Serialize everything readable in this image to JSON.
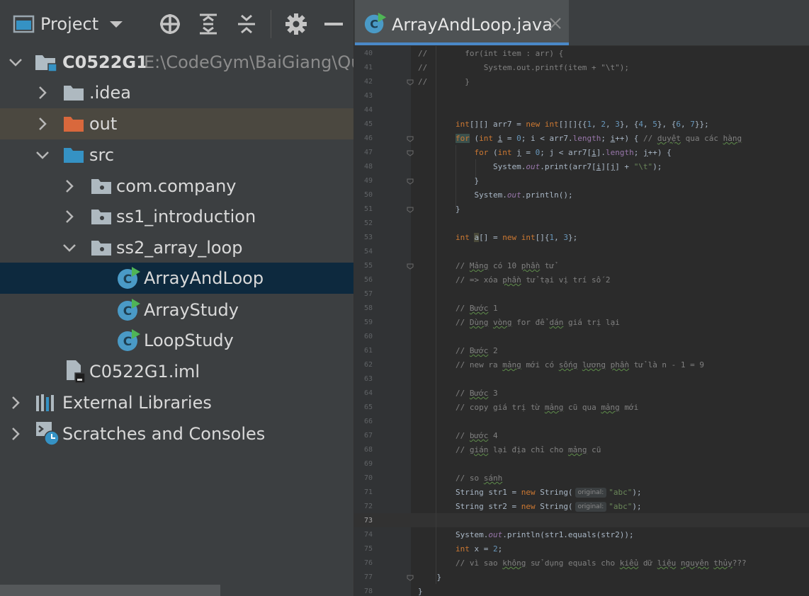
{
  "project": {
    "title": "Project",
    "root": {
      "name": "C0522G1",
      "path": "E:\\CodeGym\\BaiGiang\\Qua"
    },
    "items": [
      {
        "label": ".idea"
      },
      {
        "label": "out"
      },
      {
        "label": "src"
      },
      {
        "label": "com.company"
      },
      {
        "label": "ss1_introduction"
      },
      {
        "label": "ss2_array_loop"
      },
      {
        "label": "ArrayAndLoop"
      },
      {
        "label": "ArrayStudy"
      },
      {
        "label": "LoopStudy"
      },
      {
        "label": "C0522G1.iml"
      },
      {
        "label": "External Libraries"
      },
      {
        "label": "Scratches and Consoles"
      }
    ]
  },
  "editor": {
    "tab_title": "ArrayAndLoop.java",
    "hint_label": "original:",
    "current_line": "73",
    "lines": [
      {
        "n": "40",
        "t": "//        for(int item : arr) {"
      },
      {
        "n": "41",
        "t": "//            System.out.printf(item + \"\\t\");"
      },
      {
        "n": "42",
        "t": "//        }"
      },
      {
        "n": "43",
        "t": ""
      },
      {
        "n": "44",
        "t": ""
      },
      {
        "n": "45",
        "t": "        int[][] arr7 = new int[][]{{1, 2, 3}, {4, 5}, {6, 7}};"
      },
      {
        "n": "46",
        "t": "        for (int i = 0; i < arr7.length; i++) { // duyệt qua các hàng"
      },
      {
        "n": "47",
        "t": "            for (int j = 0; j < arr7[i].length; j++) {"
      },
      {
        "n": "48",
        "t": "                System.out.print(arr7[i][j] + \"\\t\");"
      },
      {
        "n": "49",
        "t": "            }"
      },
      {
        "n": "50",
        "t": "            System.out.println();"
      },
      {
        "n": "51",
        "t": "        }"
      },
      {
        "n": "52",
        "t": ""
      },
      {
        "n": "53",
        "t": "        int a[] = new int[]{1, 3};"
      },
      {
        "n": "54",
        "t": ""
      },
      {
        "n": "55",
        "t": "        // Mảng có 10 phần tử"
      },
      {
        "n": "56",
        "t": "        // => xóa phần tử tại vị trí số 2"
      },
      {
        "n": "57",
        "t": ""
      },
      {
        "n": "58",
        "t": "        // Bước 1"
      },
      {
        "n": "59",
        "t": "        // Dùng vòng for để dán giá trị lại"
      },
      {
        "n": "60",
        "t": ""
      },
      {
        "n": "61",
        "t": "        // Bước 2"
      },
      {
        "n": "62",
        "t": "        // new ra mảng mới có sống lương phần tử là n - 1 = 9"
      },
      {
        "n": "63",
        "t": ""
      },
      {
        "n": "64",
        "t": "        // Bước 3"
      },
      {
        "n": "65",
        "t": "        // copy giá trị từ mảng cũ qua mảng mới"
      },
      {
        "n": "66",
        "t": ""
      },
      {
        "n": "67",
        "t": "        // bước 4"
      },
      {
        "n": "68",
        "t": "        // gián lại địa chỉ cho mảng cũ"
      },
      {
        "n": "69",
        "t": ""
      },
      {
        "n": "70",
        "t": "        // so sánh"
      },
      {
        "n": "71",
        "t": "        String str1 = new String(original: \"abc\");"
      },
      {
        "n": "72",
        "t": "        String str2 = new String(original: \"abc\");"
      },
      {
        "n": "73",
        "t": ""
      },
      {
        "n": "74",
        "t": "        System.out.println(str1.equals(str2));"
      },
      {
        "n": "75",
        "t": "        int x = 2;"
      },
      {
        "n": "76",
        "t": "        // vì sao không sử dụng equals cho kiểu dữ liệu nguyên thủy???"
      },
      {
        "n": "77",
        "t": "    }"
      },
      {
        "n": "78",
        "t": "}"
      }
    ]
  }
}
